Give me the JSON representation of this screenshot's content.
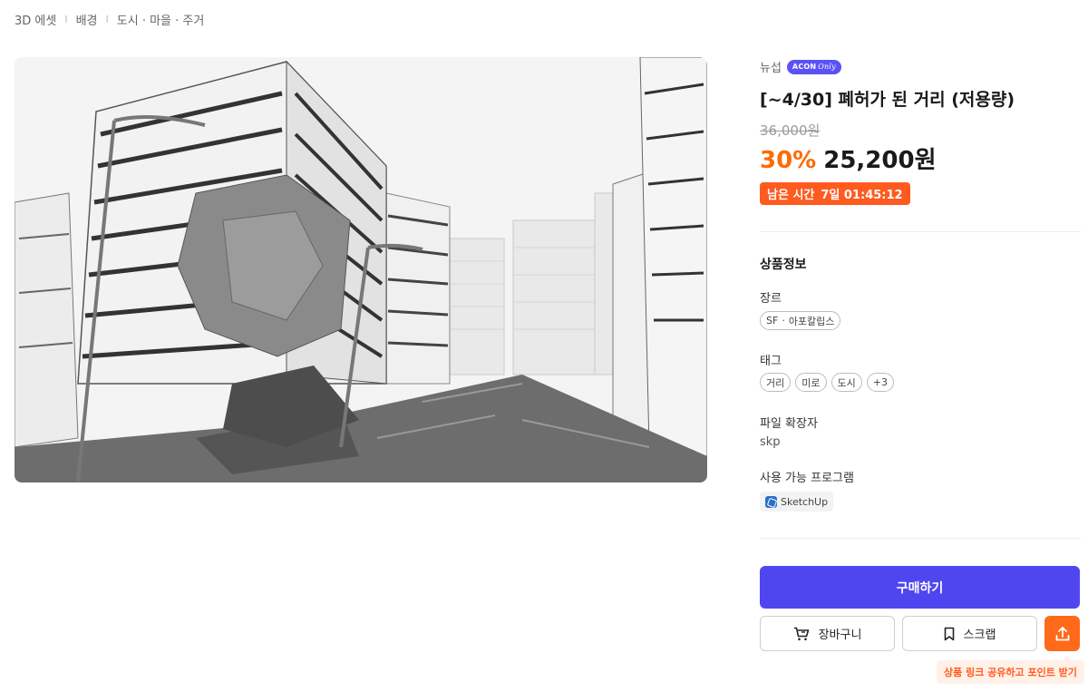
{
  "breadcrumb": {
    "items": [
      "3D 에셋",
      "배경",
      "도시 · 마을 · 주거"
    ],
    "separator": "I"
  },
  "product_image": {
    "description_icon": "ruined-city-street-image"
  },
  "seller": {
    "name": "뉴섭",
    "badge_main": "ACON",
    "badge_sub": "Only"
  },
  "product": {
    "title": "[~4/30] 폐허가 된 거리 (저용량)",
    "original_price": "36,000원",
    "discount": "30%",
    "sale_price": "25,200원",
    "timer_label": "남은 시간",
    "timer_value": "7일 01:45:12"
  },
  "info": {
    "section_title": "상품정보",
    "genre_label": "장르",
    "genre_values": [
      "SF",
      "아포칼립스"
    ],
    "genre_separator": "·",
    "tags_label": "태그",
    "tags": [
      "거리",
      "미로",
      "도시",
      "+3"
    ],
    "file_ext_label": "파일 확장자",
    "file_ext_value": "skp",
    "program_label": "사용 가능 프로그램",
    "program_value": "SketchUp"
  },
  "actions": {
    "buy_label": "구매하기",
    "cart_label": "장바구니",
    "scrap_label": "스크랩",
    "share_tooltip": "상품 링크 공유하고 포인트 받기"
  },
  "colors": {
    "accent_purple": "#5046f0",
    "accent_orange": "#ff6a1a",
    "discount_orange": "#ff6a00",
    "timer_bg": "#ff5a1f"
  }
}
